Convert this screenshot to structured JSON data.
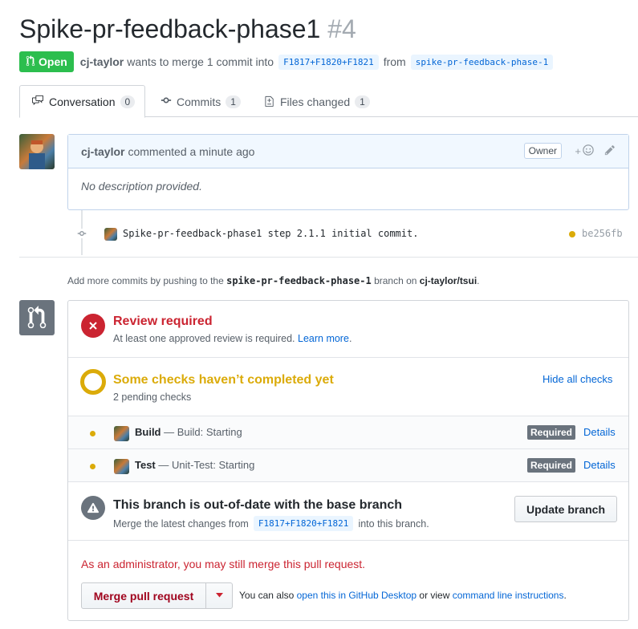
{
  "pr": {
    "title": "Spike-pr-feedback-phase1",
    "number": "#4",
    "state": "Open",
    "author": "cj-taylor",
    "merge_text_1": "wants to merge 1 commit into",
    "base_ref": "F1817+F1820+F1821",
    "merge_text_2": "from",
    "head_ref": "spike-pr-feedback-phase-1"
  },
  "tabs": [
    {
      "label": "Conversation",
      "count": "0"
    },
    {
      "label": "Commits",
      "count": "1"
    },
    {
      "label": "Files changed",
      "count": "1"
    }
  ],
  "comment": {
    "author": "cj-taylor",
    "action": "commented a minute ago",
    "role_badge": "Owner",
    "reaction_label": "+",
    "body": "No description provided."
  },
  "commit": {
    "message": "Spike-pr-feedback-phase1 step 2.1.1 initial commit.",
    "sha": "be256fb"
  },
  "hint": {
    "pre": "Add more commits by pushing to the",
    "branch": "spike-pr-feedback-phase-1",
    "mid": "branch on",
    "repo": "cj-taylor/tsui",
    "post": "."
  },
  "merge": {
    "review": {
      "title": "Review required",
      "sub": "At least one approved review is required.",
      "link": "Learn more",
      "post": "."
    },
    "checks": {
      "title": "Some checks haven’t completed yet",
      "sub": "2 pending checks",
      "toggle": "Hide all checks",
      "items": [
        {
          "name": "Build",
          "desc": "— Build: Starting",
          "badge": "Required",
          "link": "Details"
        },
        {
          "name": "Test",
          "desc": "— Unit-Test: Starting",
          "badge": "Required",
          "link": "Details"
        }
      ]
    },
    "outdated": {
      "title": "This branch is out-of-date with the base branch",
      "sub_pre": "Merge the latest changes from",
      "sub_ref": "F1817+F1820+F1821",
      "sub_post": "into this branch.",
      "button": "Update branch"
    },
    "admin_message": "As an administrator, you may still merge this pull request.",
    "merge_button": "Merge pull request",
    "alt": {
      "pre": "You can also",
      "link1": "open this in GitHub Desktop",
      "mid": "or view",
      "link2": "command line instructions",
      "post": "."
    }
  },
  "colors": {
    "open_green": "#2cbe4e",
    "review_red": "#cb2431",
    "pending_yellow": "#dbab09",
    "link_blue": "#0366d6"
  }
}
